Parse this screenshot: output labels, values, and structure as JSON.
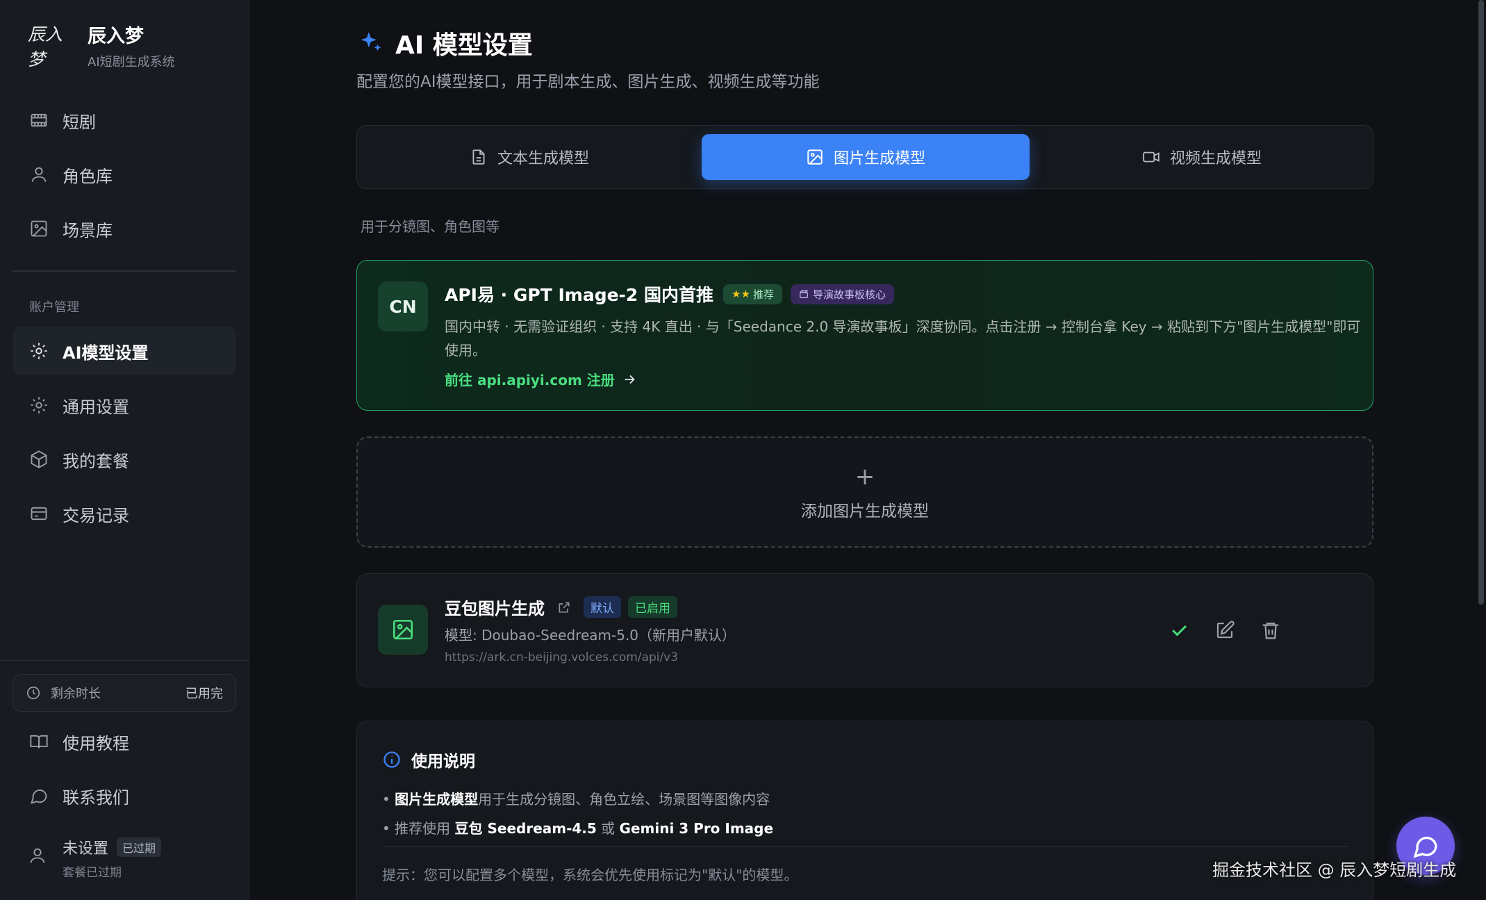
{
  "brand": {
    "logo_text": "辰入梦",
    "name": "辰入梦",
    "subtitle": "AI短剧生成系统"
  },
  "sidebar": {
    "items": [
      {
        "label": "短剧",
        "icon": "film-icon"
      },
      {
        "label": "角色库",
        "icon": "user-icon"
      },
      {
        "label": "场景库",
        "icon": "image-icon"
      }
    ],
    "section_label": "账户管理",
    "account_items": [
      {
        "label": "AI模型设置",
        "icon": "sparkle-settings-icon",
        "active": true
      },
      {
        "label": "通用设置",
        "icon": "gear-icon"
      },
      {
        "label": "我的套餐",
        "icon": "package-icon"
      },
      {
        "label": "交易记录",
        "icon": "card-icon"
      }
    ],
    "time_label": "剩余时长",
    "time_value": "已用完",
    "footer_items": [
      {
        "label": "使用教程",
        "icon": "book-icon"
      },
      {
        "label": "联系我们",
        "icon": "chat-icon"
      }
    ],
    "user": {
      "name": "未设置",
      "badge": "已过期",
      "sub": "套餐已过期"
    }
  },
  "header": {
    "title": "AI 模型设置",
    "subtitle": "配置您的AI模型接口，用于剧本生成、图片生成、视频生成等功能"
  },
  "tabs": [
    {
      "label": "文本生成模型",
      "icon": "document-icon",
      "active": false
    },
    {
      "label": "图片生成模型",
      "icon": "image-icon",
      "active": true
    },
    {
      "label": "视频生成模型",
      "icon": "video-icon",
      "active": false
    }
  ],
  "hint": "用于分镜图、角色图等",
  "promo": {
    "badge": "CN",
    "title": "API易 · GPT Image-2 国内首推",
    "tag_recommend": "推荐",
    "tag_core": "导演故事板核心",
    "description": "国内中转 · 无需验证组织 · 支持 4K 直出 · 与「Seedance 2.0 导演故事板」深度协同。点击注册 → 控制台拿 Key → 粘贴到下方\"图片生成模型\"即可使用。",
    "link": "前往 api.apiyi.com 注册"
  },
  "add_model": {
    "plus": "+",
    "label": "添加图片生成模型"
  },
  "model_card": {
    "name": "豆包图片生成",
    "tag_default": "默认",
    "tag_enabled": "已启用",
    "model_line": "模型: Doubao-Seedream-5.0（新用户默认）",
    "url": "https://ark.cn-beijing.volces.com/api/v3"
  },
  "usage": {
    "title": "使用说明",
    "line1_bold": "图片生成模型",
    "line1_rest": "用于生成分镜图、角色立绘、场景图等图像内容",
    "line2_prefix": "推荐使用 ",
    "line2_model1": "豆包 Seedream-4.5",
    "line2_or": " 或 ",
    "line2_model2": "Gemini 3 Pro Image",
    "tip": "提示：您可以配置多个模型，系统会优先使用标记为\"默认\"的模型。"
  },
  "watermark": "掘金技术社区 @ 辰入梦短剧生成",
  "colors": {
    "accent": "#3b82f6",
    "success": "#4ade80",
    "promo_border": "#22a564",
    "chat": "#6d5ae6"
  }
}
